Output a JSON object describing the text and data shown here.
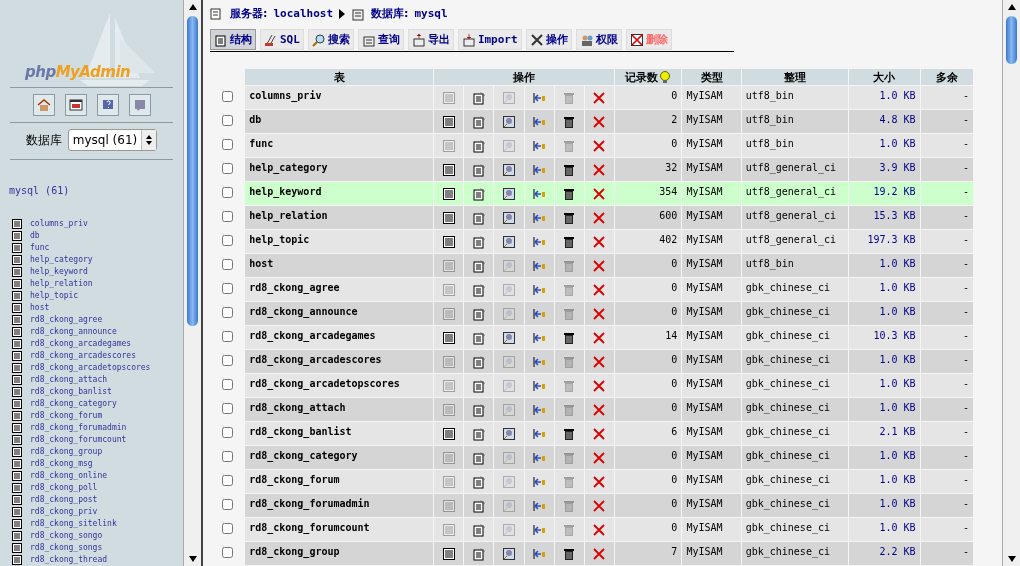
{
  "sidebar": {
    "logo_php": "php",
    "logo_myadmin": "MyAdmin",
    "db_label": "数据库",
    "db_select": "mysql (61)",
    "db_heading": "mysql (61)",
    "tables": [
      "columns_priv",
      "db",
      "func",
      "help_category",
      "help_keyword",
      "help_relation",
      "help_topic",
      "host",
      "rd8_ckong_agree",
      "rd8_ckong_announce",
      "rd8_ckong_arcadegames",
      "rd8_ckong_arcadescores",
      "rd8_ckong_arcadetopscores",
      "rd8_ckong_attach",
      "rd8_ckong_banlist",
      "rd8_ckong_category",
      "rd8_ckong_forum",
      "rd8_ckong_forumadmin",
      "rd8_ckong_forumcount",
      "rd8_ckong_group",
      "rd8_ckong_msg",
      "rd8_ckong_online",
      "rd8_ckong_poll",
      "rd8_ckong_post",
      "rd8_ckong_priv",
      "rd8_ckong_sitelink",
      "rd8_ckong_songo",
      "rd8_ckong_songs",
      "rd8_ckong_thread"
    ]
  },
  "breadcrumb": {
    "server_label": "服务器:",
    "server": "localhost",
    "db_label": "数据库:",
    "db": "mysql"
  },
  "tabs": [
    {
      "label": "结构",
      "selected": true,
      "kind": "structure"
    },
    {
      "label": "SQL",
      "selected": false,
      "kind": "sql"
    },
    {
      "label": "搜索",
      "selected": false,
      "kind": "search"
    },
    {
      "label": "查询",
      "selected": false,
      "kind": "query"
    },
    {
      "label": "导出",
      "selected": false,
      "kind": "export"
    },
    {
      "label": "Import",
      "selected": false,
      "kind": "import"
    },
    {
      "label": "操作",
      "selected": false,
      "kind": "operations"
    },
    {
      "label": "权限",
      "selected": false,
      "kind": "privileges"
    },
    {
      "label": "删除",
      "selected": false,
      "kind": "drop"
    }
  ],
  "table": {
    "columns": [
      "表",
      "操作",
      "记录数",
      "类型",
      "整理",
      "大小",
      "多余"
    ],
    "rows": [
      {
        "name": "columns_priv",
        "checked": false,
        "has_rows": false,
        "highlighted": false,
        "records": "0",
        "type": "MyISAM",
        "collation": "utf8_bin",
        "size": "1.0 KB",
        "overhead": "-"
      },
      {
        "name": "db",
        "checked": false,
        "has_rows": true,
        "highlighted": false,
        "records": "2",
        "type": "MyISAM",
        "collation": "utf8_bin",
        "size": "4.8 KB",
        "overhead": "-"
      },
      {
        "name": "func",
        "checked": false,
        "has_rows": false,
        "highlighted": false,
        "records": "0",
        "type": "MyISAM",
        "collation": "utf8_bin",
        "size": "1.0 KB",
        "overhead": "-"
      },
      {
        "name": "help_category",
        "checked": false,
        "has_rows": true,
        "highlighted": false,
        "records": "32",
        "type": "MyISAM",
        "collation": "utf8_general_ci",
        "size": "3.9 KB",
        "overhead": "-"
      },
      {
        "name": "help_keyword",
        "checked": false,
        "has_rows": true,
        "highlighted": true,
        "records": "354",
        "type": "MyISAM",
        "collation": "utf8_general_ci",
        "size": "19.2 KB",
        "overhead": "-"
      },
      {
        "name": "help_relation",
        "checked": false,
        "has_rows": true,
        "highlighted": false,
        "records": "600",
        "type": "MyISAM",
        "collation": "utf8_general_ci",
        "size": "15.3 KB",
        "overhead": "-"
      },
      {
        "name": "help_topic",
        "checked": false,
        "has_rows": true,
        "highlighted": false,
        "records": "402",
        "type": "MyISAM",
        "collation": "utf8_general_ci",
        "size": "197.3 KB",
        "overhead": "-"
      },
      {
        "name": "host",
        "checked": false,
        "has_rows": false,
        "highlighted": false,
        "records": "0",
        "type": "MyISAM",
        "collation": "utf8_bin",
        "size": "1.0 KB",
        "overhead": "-"
      },
      {
        "name": "rd8_ckong_agree",
        "checked": false,
        "has_rows": false,
        "highlighted": false,
        "records": "0",
        "type": "MyISAM",
        "collation": "gbk_chinese_ci",
        "size": "1.0 KB",
        "overhead": "-"
      },
      {
        "name": "rd8_ckong_announce",
        "checked": false,
        "has_rows": false,
        "highlighted": false,
        "records": "0",
        "type": "MyISAM",
        "collation": "gbk_chinese_ci",
        "size": "1.0 KB",
        "overhead": "-"
      },
      {
        "name": "rd8_ckong_arcadegames",
        "checked": false,
        "has_rows": true,
        "highlighted": false,
        "records": "14",
        "type": "MyISAM",
        "collation": "gbk_chinese_ci",
        "size": "10.3 KB",
        "overhead": "-"
      },
      {
        "name": "rd8_ckong_arcadescores",
        "checked": false,
        "has_rows": false,
        "highlighted": false,
        "records": "0",
        "type": "MyISAM",
        "collation": "gbk_chinese_ci",
        "size": "1.0 KB",
        "overhead": "-"
      },
      {
        "name": "rd8_ckong_arcadetopscores",
        "checked": false,
        "has_rows": false,
        "highlighted": false,
        "records": "0",
        "type": "MyISAM",
        "collation": "gbk_chinese_ci",
        "size": "1.0 KB",
        "overhead": "-"
      },
      {
        "name": "rd8_ckong_attach",
        "checked": false,
        "has_rows": false,
        "highlighted": false,
        "records": "0",
        "type": "MyISAM",
        "collation": "gbk_chinese_ci",
        "size": "1.0 KB",
        "overhead": "-"
      },
      {
        "name": "rd8_ckong_banlist",
        "checked": false,
        "has_rows": true,
        "highlighted": false,
        "records": "6",
        "type": "MyISAM",
        "collation": "gbk_chinese_ci",
        "size": "2.1 KB",
        "overhead": "-"
      },
      {
        "name": "rd8_ckong_category",
        "checked": false,
        "has_rows": false,
        "highlighted": false,
        "records": "0",
        "type": "MyISAM",
        "collation": "gbk_chinese_ci",
        "size": "1.0 KB",
        "overhead": "-"
      },
      {
        "name": "rd8_ckong_forum",
        "checked": false,
        "has_rows": false,
        "highlighted": false,
        "records": "0",
        "type": "MyISAM",
        "collation": "gbk_chinese_ci",
        "size": "1.0 KB",
        "overhead": "-"
      },
      {
        "name": "rd8_ckong_forumadmin",
        "checked": false,
        "has_rows": false,
        "highlighted": false,
        "records": "0",
        "type": "MyISAM",
        "collation": "gbk_chinese_ci",
        "size": "1.0 KB",
        "overhead": "-"
      },
      {
        "name": "rd8_ckong_forumcount",
        "checked": false,
        "has_rows": false,
        "highlighted": false,
        "records": "0",
        "type": "MyISAM",
        "collation": "gbk_chinese_ci",
        "size": "1.0 KB",
        "overhead": "-"
      },
      {
        "name": "rd8_ckong_group",
        "checked": false,
        "has_rows": true,
        "highlighted": false,
        "records": "7",
        "type": "MyISAM",
        "collation": "gbk_chinese_ci",
        "size": "2.2 KB",
        "overhead": "-"
      }
    ]
  }
}
